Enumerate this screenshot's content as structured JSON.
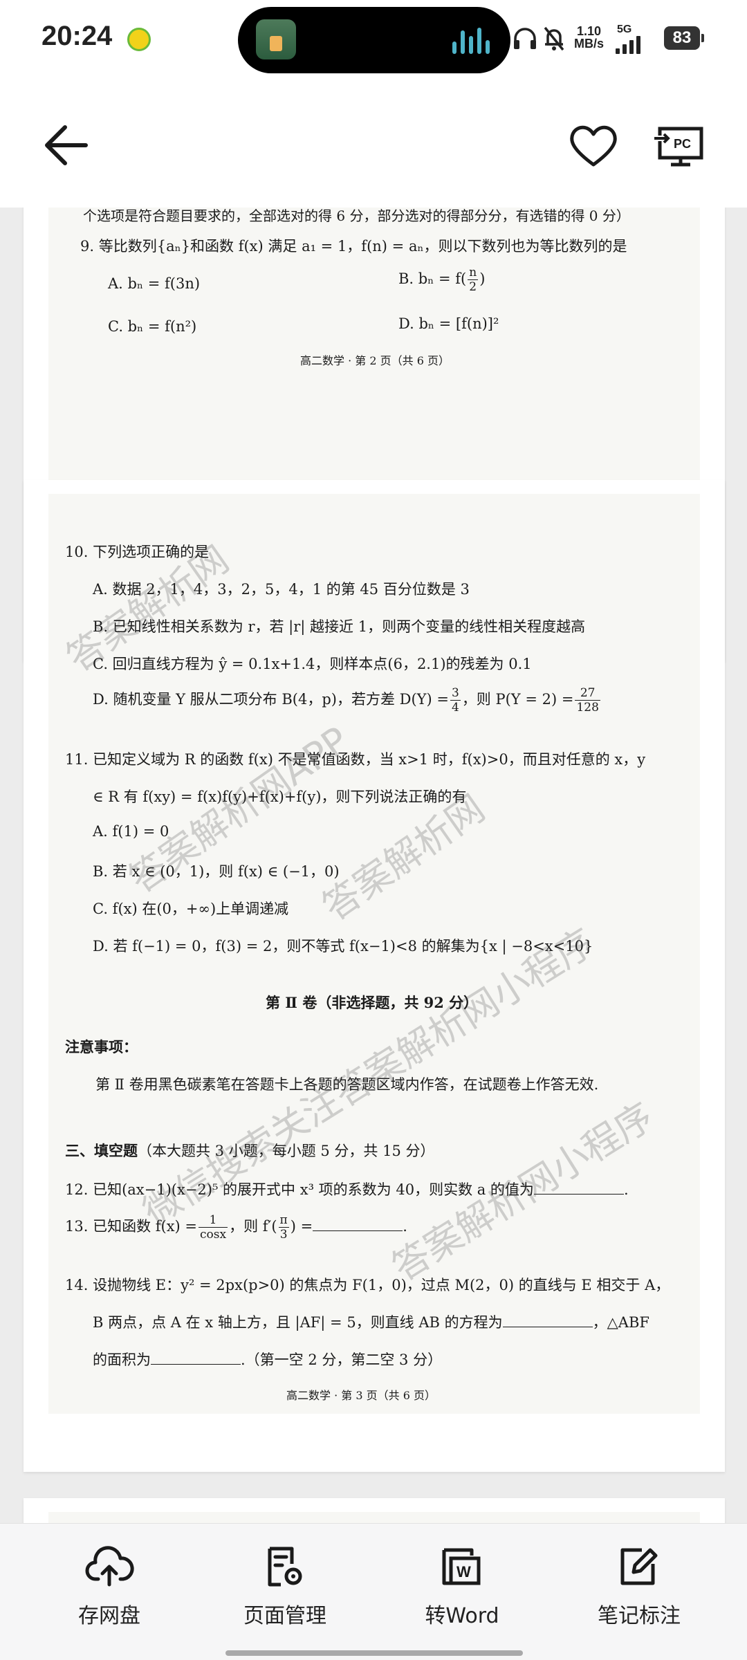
{
  "status_bar": {
    "time": "20:24",
    "net_speed_value": "1.10",
    "net_speed_unit": "MB/s",
    "network": "5G",
    "battery": "83"
  },
  "toolbar": {
    "save_cloud": "存网盘",
    "page_manage": "页面管理",
    "to_word": "转Word",
    "notes": "笔记标注"
  },
  "page1": {
    "line_top": "个选项是符合题目要求的，全部选对的得 6 分，部分选对的得部分分，有选错的得 0 分）",
    "q9": "9.  等比数列{aₙ}和函数 f(x) 满足 a₁ = 1，f(n) = aₙ，则以下数列也为等比数列的是",
    "q9_a": "A.  bₙ = f(3n)",
    "q9_b_pre": "B.  bₙ = f(",
    "q9_b_num": "n",
    "q9_b_den": "2",
    "q9_b_post": ")",
    "q9_c": "C.  bₙ = f(n²)",
    "q9_d": "D.  bₙ = [f(n)]²",
    "footer": "高二数学 · 第 2 页（共 6 页）"
  },
  "page2": {
    "q10": "10.  下列选项正确的是",
    "q10_a": "A.  数据 2，1，4，3，2，5，4，1 的第 45 百分位数是 3",
    "q10_b": "B.  已知线性相关系数为 r，若 |r| 越接近 1，则两个变量的线性相关程度越高",
    "q10_c": "C.  回归直线方程为 ŷ = 0.1x+1.4，则样本点(6，2.1)的残差为 0.1",
    "q10_d_pre": "D.  随机变量 Y 服从二项分布 B(4，p)，若方差 D(Y) =",
    "q10_d_f1n": "3",
    "q10_d_f1d": "4",
    "q10_d_mid": "，则 P(Y = 2) =",
    "q10_d_f2n": "27",
    "q10_d_f2d": "128",
    "q11_l1": "11.  已知定义域为 R 的函数 f(x) 不是常值函数，当 x>1 时，f(x)>0，而且对任意的 x，y",
    "q11_l2": "∈ R 有 f(xy) = f(x)f(y)+f(x)+f(y)，则下列说法正确的有",
    "q11_a": "A.  f(1) = 0",
    "q11_b": "B.  若 x ∈ (0，1)，则 f(x) ∈ (−1，0)",
    "q11_c": "C.  f(x) 在(0，+∞)上单调递减",
    "q11_d": "D.  若 f(−1) = 0，f(3) = 2，则不等式 f(x−1)<8 的解集为{x | −8<x<10}",
    "part2": "第 Ⅱ 卷（非选择题，共 92 分）",
    "notice_title": "注意事项：",
    "notice_text": "第 Ⅱ 卷用黑色碳素笔在答题卡上各题的答题区域内作答，在试题卷上作答无效.",
    "sec3_title": "三、填空题",
    "sec3_rest": "（本大题共 3 小题，每小题 5 分，共 15 分）",
    "q12": "12.  已知(ax−1)(x−2)⁵ 的展开式中 x³ 项的系数为 40，则实数 a 的值为",
    "q13_pre": "13.  已知函数 f(x) =",
    "q13_fn": "1",
    "q13_fd": "cosx",
    "q13_mid": "，则 f′(",
    "q13_f2n": "π",
    "q13_f2d": "3",
    "q13_post": ") =",
    "q14_l1": "14.  设抛物线 E：y² = 2px(p>0) 的焦点为 F(1，0)，过点 M(2，0) 的直线与 E 相交于 A，",
    "q14_l2": "B 两点，点 A 在 x 轴上方，且 |AF| = 5，则直线 AB 的方程为",
    "q14_l2b": "，△ABF",
    "q14_l3a": "的面积为",
    "q14_l3b": ".（第一空 2 分，第二空 3 分）",
    "footer": "高二数学 · 第 3 页（共 6 页）"
  },
  "watermarks": {
    "w1": "答案解析网",
    "w2": "答案解析网APP",
    "w3": "答案解析网",
    "w4": "微信搜索关注答案解析网小程序",
    "w5": "答案解析网小程序"
  }
}
